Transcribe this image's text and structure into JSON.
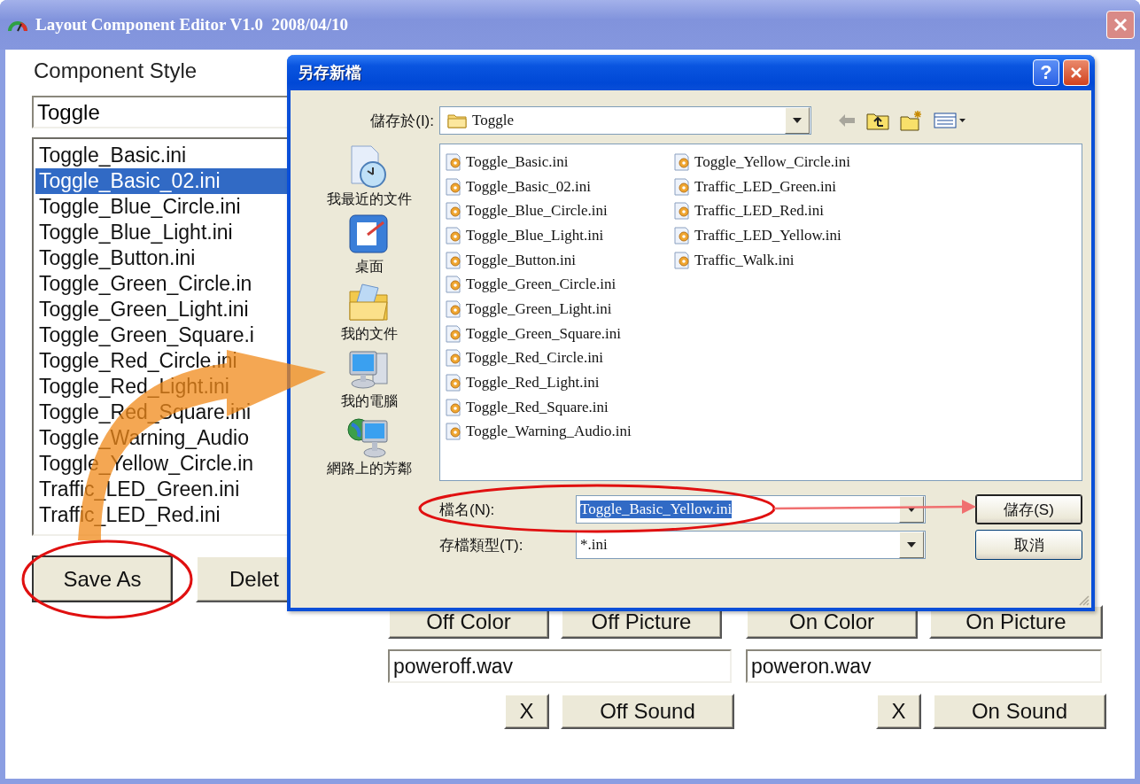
{
  "window": {
    "title": "Layout Component Editor V1.0  2008/04/10"
  },
  "component_style": {
    "label": "Component Style",
    "value": "Toggle"
  },
  "style_list": [
    {
      "label": "Toggle_Basic.ini",
      "selected": false
    },
    {
      "label": "Toggle_Basic_02.ini",
      "selected": true
    },
    {
      "label": "Toggle_Blue_Circle.ini",
      "selected": false
    },
    {
      "label": "Toggle_Blue_Light.ini",
      "selected": false
    },
    {
      "label": "Toggle_Button.ini",
      "selected": false
    },
    {
      "label": "Toggle_Green_Circle.in",
      "selected": false
    },
    {
      "label": "Toggle_Green_Light.ini",
      "selected": false
    },
    {
      "label": "Toggle_Green_Square.i",
      "selected": false
    },
    {
      "label": "Toggle_Red_Circle.ini",
      "selected": false
    },
    {
      "label": "Toggle_Red_Light.ini",
      "selected": false
    },
    {
      "label": "Toggle_Red_Square.ini",
      "selected": false
    },
    {
      "label": "Toggle_Warning_Audio",
      "selected": false
    },
    {
      "label": "Toggle_Yellow_Circle.in",
      "selected": false
    },
    {
      "label": "Traffic_LED_Green.ini",
      "selected": false
    },
    {
      "label": "Traffic_LED_Red.ini",
      "selected": false
    }
  ],
  "left_buttons": [
    "Save As",
    "Delet"
  ],
  "picture_buttons": [
    "Off Color",
    "Off Picture",
    "On Color",
    "On Picture"
  ],
  "sounds": [
    {
      "file": "poweroff.wav",
      "clear": "X",
      "button": "Off Sound"
    },
    {
      "file": "poweron.wav",
      "clear": "X",
      "button": "On Sound"
    }
  ],
  "save_dialog": {
    "title": "另存新檔",
    "help": "?",
    "save_in": {
      "label": "儲存於(I):",
      "value": "Toggle"
    },
    "places": [
      {
        "label": "我最近的文件",
        "kind": "recent"
      },
      {
        "label": "桌面",
        "kind": "desktop"
      },
      {
        "label": "我的文件",
        "kind": "documents"
      },
      {
        "label": "我的電腦",
        "kind": "computer"
      },
      {
        "label": "網路上的芳鄰",
        "kind": "network"
      }
    ],
    "files": [
      "Toggle_Basic.ini",
      "Toggle_Basic_02.ini",
      "Toggle_Blue_Circle.ini",
      "Toggle_Blue_Light.ini",
      "Toggle_Button.ini",
      "Toggle_Green_Circle.ini",
      "Toggle_Green_Light.ini",
      "Toggle_Green_Square.ini",
      "Toggle_Red_Circle.ini",
      "Toggle_Red_Light.ini",
      "Toggle_Red_Square.ini",
      "Toggle_Warning_Audio.ini",
      "Toggle_Yellow_Circle.ini",
      "Traffic_LED_Green.ini",
      "Traffic_LED_Red.ini",
      "Traffic_LED_Yellow.ini",
      "Traffic_Walk.ini"
    ],
    "file_name": {
      "label": "檔名(N):",
      "value": "Toggle_Basic_Yellow.ini"
    },
    "file_type": {
      "label": "存檔類型(T):",
      "value": "*.ini"
    },
    "buttons": [
      "儲存(S)",
      "取消"
    ]
  }
}
